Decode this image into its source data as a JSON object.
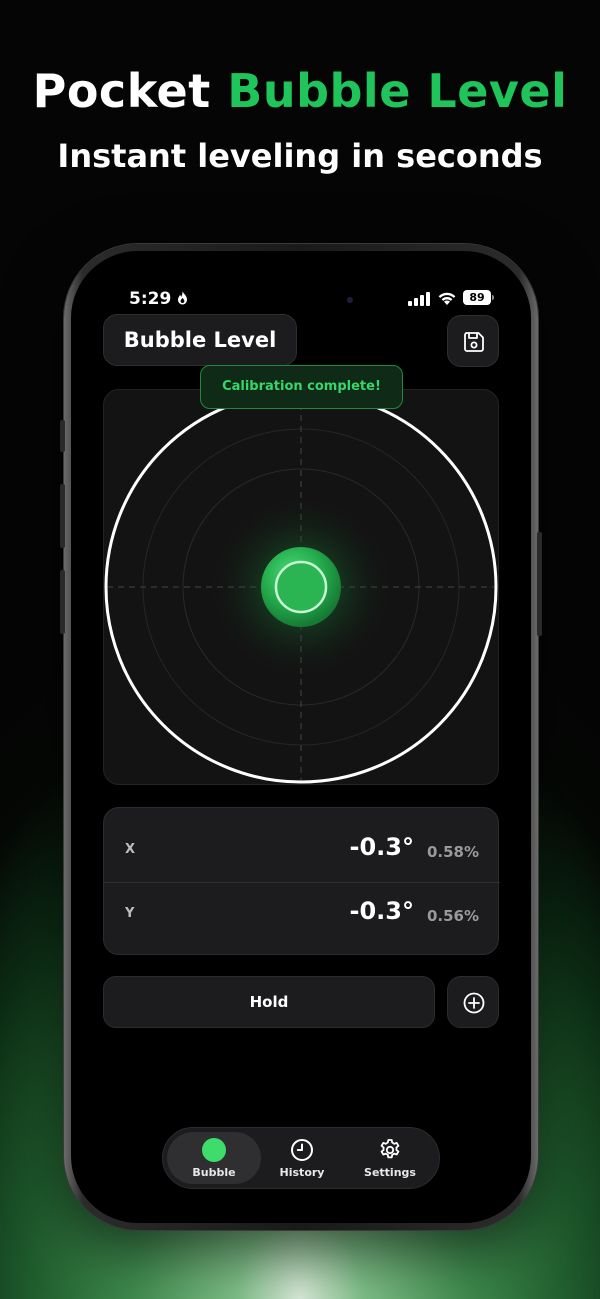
{
  "promo": {
    "title_part1": "Pocket ",
    "title_part2": "Bubble Level",
    "subtitle": "Instant leveling in seconds"
  },
  "status_bar": {
    "time": "5:29",
    "battery": "89",
    "icons": [
      "flame-icon",
      "cellular-signal-icon",
      "wifi-icon",
      "battery-icon"
    ]
  },
  "header": {
    "title": "Bubble Level",
    "save_icon": "floppy-disk-icon"
  },
  "toast": {
    "message": "Calibration complete!"
  },
  "level": {
    "x_deg": -0.3,
    "y_deg": -0.3
  },
  "readings": [
    {
      "axis": "X",
      "degrees": "-0.3°",
      "percent": "0.58%"
    },
    {
      "axis": "Y",
      "degrees": "-0.3°",
      "percent": "0.56%"
    }
  ],
  "actions": {
    "hold_label": "Hold",
    "add_icon": "plus-circle-icon"
  },
  "tabs": [
    {
      "label": "Bubble",
      "icon": "bubble-dot-icon",
      "active": true
    },
    {
      "label": "History",
      "icon": "clock-icon",
      "active": false
    },
    {
      "label": "Settings",
      "icon": "gear-icon",
      "active": false
    }
  ],
  "colors": {
    "accent": "#1fc55b",
    "bubble": "#3ddc6b",
    "toast_text": "#37d66a",
    "background": "#000000"
  }
}
